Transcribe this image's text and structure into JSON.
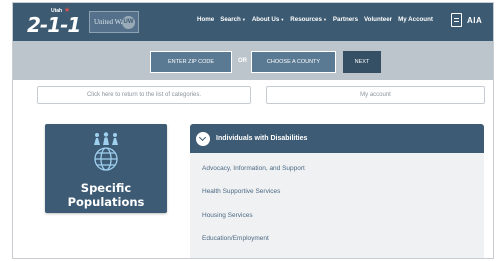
{
  "header": {
    "logo_number": "2-1-1",
    "logo_state": "Utah",
    "partner_logo_text": "United Way",
    "nav": [
      {
        "label": "Home",
        "dropdown": false
      },
      {
        "label": "Search",
        "dropdown": true
      },
      {
        "label": "About Us",
        "dropdown": true
      },
      {
        "label": "Resources",
        "dropdown": true
      },
      {
        "label": "Partners",
        "dropdown": false
      },
      {
        "label": "Volunteer",
        "dropdown": false
      },
      {
        "label": "My Account",
        "dropdown": false
      }
    ],
    "accessibility_label": "AIA"
  },
  "search": {
    "zip_label": "ENTER ZIP CODE",
    "or_label": "OR",
    "county_label": "CHOOSE A COUNTY",
    "next_label": "NEXT"
  },
  "links": {
    "return_label": "Click here to return to the list of categories.",
    "account_label": "My account"
  },
  "tile": {
    "title_line1": "Specific",
    "title_line2": "Populations",
    "icon": "people-globe-icon"
  },
  "category": {
    "title": "Individuals with Disabilities",
    "items": [
      "Advocacy, Information, and Support",
      "Health Supportive Services",
      "Housing Services",
      "Education/Employment"
    ]
  },
  "colors": {
    "header_bg": "#3c5a72",
    "strip_bg": "#bcc5cc",
    "tile_bg": "#3d5b74",
    "link_text": "#4b6a85"
  }
}
